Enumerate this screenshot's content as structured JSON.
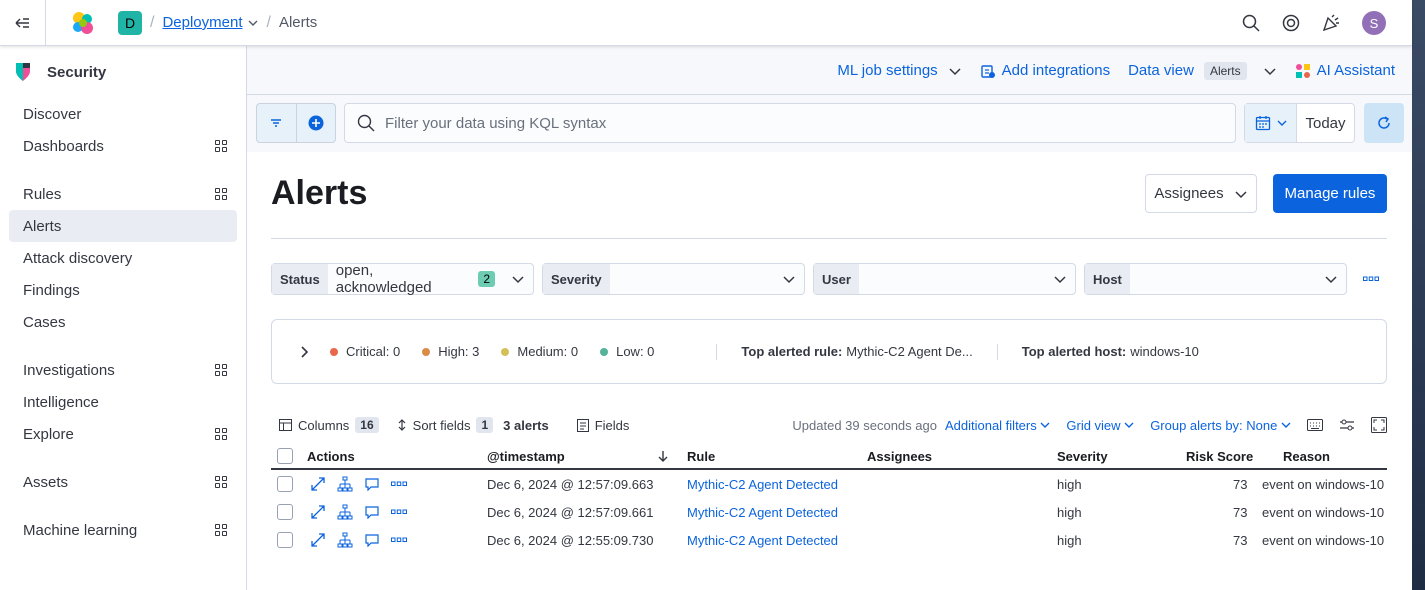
{
  "topbar": {
    "space_initial": "D",
    "breadcrumbs": [
      "Deployment",
      "Alerts"
    ],
    "user_initial": "S"
  },
  "sidebar": {
    "title": "Security",
    "groups": [
      [
        {
          "label": "Discover",
          "grid": false
        },
        {
          "label": "Dashboards",
          "grid": true
        }
      ],
      [
        {
          "label": "Rules",
          "grid": true
        },
        {
          "label": "Alerts",
          "grid": false,
          "active": true
        },
        {
          "label": "Attack discovery",
          "grid": false
        },
        {
          "label": "Findings",
          "grid": false
        },
        {
          "label": "Cases",
          "grid": false
        }
      ],
      [
        {
          "label": "Investigations",
          "grid": true
        },
        {
          "label": "Intelligence",
          "grid": false
        },
        {
          "label": "Explore",
          "grid": true
        }
      ],
      [
        {
          "label": "Assets",
          "grid": true
        }
      ],
      [
        {
          "label": "Machine learning",
          "grid": true
        }
      ]
    ]
  },
  "header2": {
    "ml_job_settings": "ML job settings",
    "add_integrations": "Add integrations",
    "data_view_label": "Data view",
    "data_view_value": "Alerts",
    "ai_assistant": "AI Assistant"
  },
  "querybar": {
    "placeholder": "Filter your data using KQL syntax",
    "date_label": "Today"
  },
  "page": {
    "title": "Alerts",
    "assignees_button": "Assignees",
    "manage_rules_button": "Manage rules"
  },
  "filters": {
    "status_label": "Status",
    "status_value": "open, acknowledged",
    "status_count": "2",
    "severity_label": "Severity",
    "user_label": "User",
    "host_label": "Host"
  },
  "summary": {
    "critical": "Critical: 0",
    "high": "High: 3",
    "medium": "Medium: 0",
    "low": "Low: 0",
    "top_rule_label": "Top alerted rule:",
    "top_rule_value": "Mythic-C2 Agent De...",
    "top_host_label": "Top alerted host:",
    "top_host_value": "windows-10"
  },
  "toolbar": {
    "columns_label": "Columns",
    "columns_count": "16",
    "sort_label": "Sort fields",
    "sort_count": "1",
    "alerts_count": "3 alerts",
    "fields_label": "Fields",
    "updated": "Updated 39 seconds ago",
    "additional_filters": "Additional filters",
    "grid_view": "Grid view",
    "group_by": "Group alerts by: None"
  },
  "table": {
    "headers": {
      "actions": "Actions",
      "timestamp": "@timestamp",
      "rule": "Rule",
      "assignees": "Assignees",
      "severity": "Severity",
      "risk_score": "Risk Score",
      "reason": "Reason"
    },
    "rows": [
      {
        "timestamp": "Dec 6, 2024 @ 12:57:09.663",
        "rule": "Mythic-C2 Agent Detected",
        "severity": "high",
        "risk_score": "73",
        "reason": "event on windows-10"
      },
      {
        "timestamp": "Dec 6, 2024 @ 12:57:09.661",
        "rule": "Mythic-C2 Agent Detected",
        "severity": "high",
        "risk_score": "73",
        "reason": "event on windows-10"
      },
      {
        "timestamp": "Dec 6, 2024 @ 12:55:09.730",
        "rule": "Mythic-C2 Agent Detected",
        "severity": "high",
        "risk_score": "73",
        "reason": "event on windows-10"
      }
    ]
  },
  "colors": {
    "accent": "#0b64dd",
    "critical": "#e7664c",
    "high": "#da8b45",
    "medium": "#d6bf57",
    "low": "#54b399"
  }
}
